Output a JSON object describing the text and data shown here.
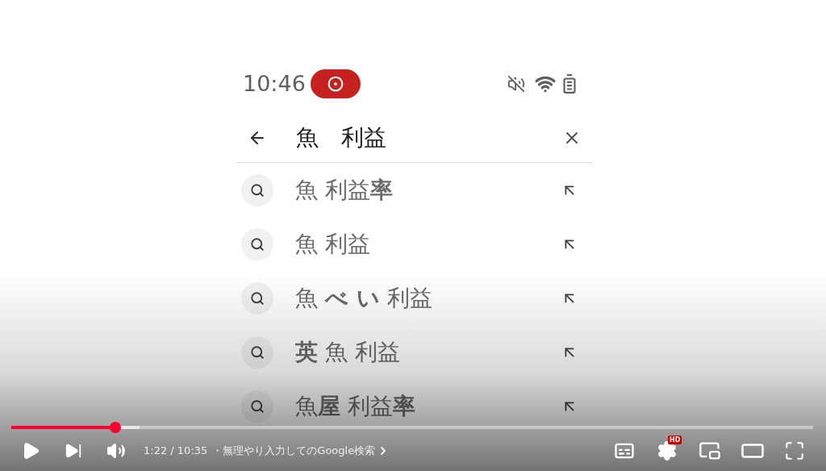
{
  "status_bar": {
    "time": "10:46"
  },
  "search": {
    "value": "魚　利益"
  },
  "suggestions": [
    {
      "text": "魚 利益**率**"
    },
    {
      "text": "魚 利益"
    },
    {
      "text": "魚 **べ い** 利益"
    },
    {
      "text": "**英** 魚 利益"
    },
    {
      "text": "魚**屋** 利益**率**"
    }
  ],
  "player": {
    "progress": {
      "level": 0.13
    },
    "time": "1:22 / 10:35",
    "chapter": "・無理やり入力してのGoogle検索",
    "quality_badge": "HD"
  }
}
